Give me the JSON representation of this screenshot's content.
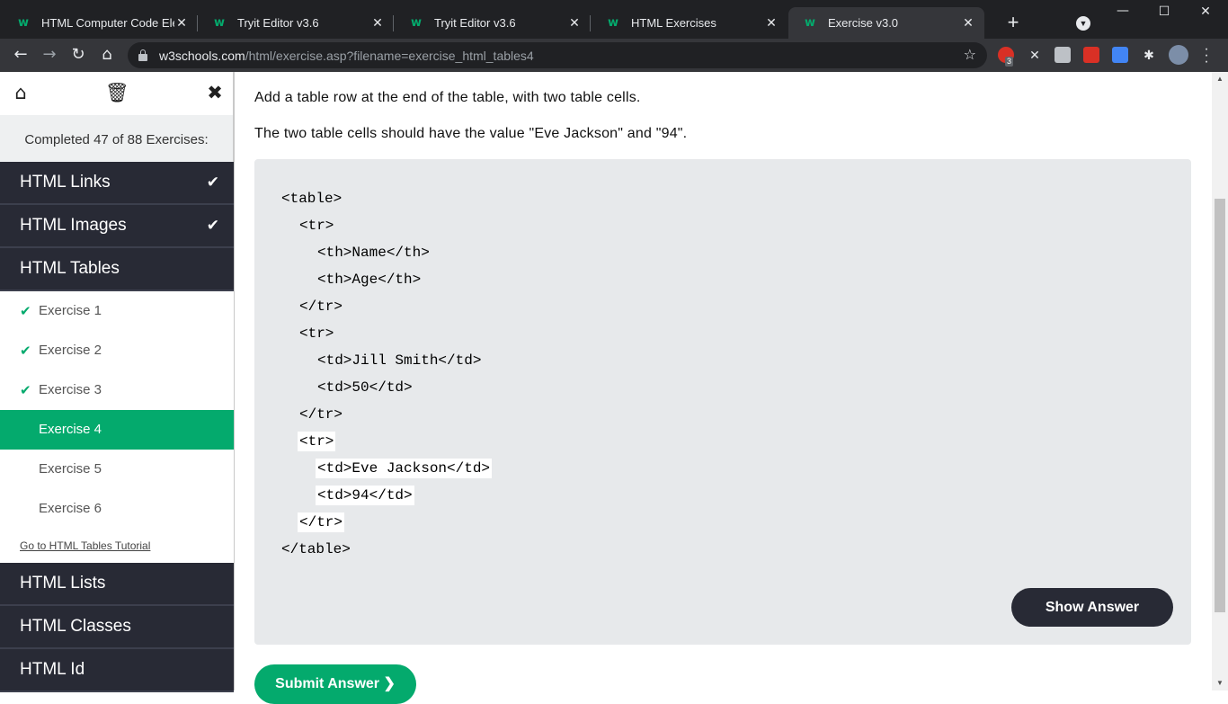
{
  "browser": {
    "tabs": [
      {
        "title": "HTML Computer Code Eleme",
        "favicon": "w3schools-icon",
        "active": false
      },
      {
        "title": "Tryit Editor v3.6",
        "favicon": "w3schools-icon",
        "active": false
      },
      {
        "title": "Tryit Editor v3.6",
        "favicon": "w3schools-icon",
        "active": false
      },
      {
        "title": "HTML Exercises",
        "favicon": "w3schools-icon",
        "active": false
      },
      {
        "title": "Exercise v3.0",
        "favicon": "w3schools-icon",
        "active": true
      }
    ],
    "url_host": "w3schools.com",
    "url_path": "/html/exercise.asp?filename=exercise_html_tables4",
    "extension_badge": "3"
  },
  "sidebar": {
    "progress_text": "Completed 47 of 88 Exercises:",
    "categories_top": [
      {
        "label": "HTML Links",
        "completed": true
      },
      {
        "label": "HTML Images",
        "completed": true
      },
      {
        "label": "HTML Tables",
        "completed": false
      }
    ],
    "exercises": [
      {
        "label": "Exercise 1",
        "completed": true,
        "active": false
      },
      {
        "label": "Exercise 2",
        "completed": true,
        "active": false
      },
      {
        "label": "Exercise 3",
        "completed": true,
        "active": false
      },
      {
        "label": "Exercise 4",
        "completed": false,
        "active": true
      },
      {
        "label": "Exercise 5",
        "completed": false,
        "active": false
      },
      {
        "label": "Exercise 6",
        "completed": false,
        "active": false
      }
    ],
    "tutorial_link": "Go to HTML Tables Tutorial",
    "categories_bottom": [
      {
        "label": "HTML Lists"
      },
      {
        "label": "HTML Classes"
      },
      {
        "label": "HTML Id"
      }
    ]
  },
  "exercise": {
    "instruction_1": "Add a table row at the end of the table, with two table cells.",
    "instruction_2": "The two table cells should have the value \"Eve Jackson\" and \"94\".",
    "code_lines": [
      {
        "text": "<table>",
        "indent": 0,
        "input": false
      },
      {
        "text": "<tr>",
        "indent": 1,
        "input": false
      },
      {
        "text": "<th>Name</th>",
        "indent": 2,
        "input": false
      },
      {
        "text": "<th>Age</th>",
        "indent": 2,
        "input": false
      },
      {
        "text": "</tr>",
        "indent": 1,
        "input": false
      },
      {
        "text": "<tr>",
        "indent": 1,
        "input": false
      },
      {
        "text": "<td>Jill Smith</td>",
        "indent": 2,
        "input": false
      },
      {
        "text": "<td>50</td>",
        "indent": 2,
        "input": false
      },
      {
        "text": "</tr>",
        "indent": 1,
        "input": false
      },
      {
        "text": "<tr>",
        "indent": 1,
        "input": true
      },
      {
        "text": "<td>Eve Jackson</td>",
        "indent": 2,
        "input": true
      },
      {
        "text": "<td>94</td>",
        "indent": 2,
        "input": true
      },
      {
        "text": "</tr>",
        "indent": 1,
        "input": true
      },
      {
        "text": "</table>",
        "indent": 0,
        "input": false
      }
    ],
    "show_answer_label": "Show Answer",
    "submit_label": "Submit Answer ❯"
  },
  "colors": {
    "accent_green": "#04aa6d",
    "dark_nav": "#282a35",
    "code_bg": "#e7e9eb"
  }
}
